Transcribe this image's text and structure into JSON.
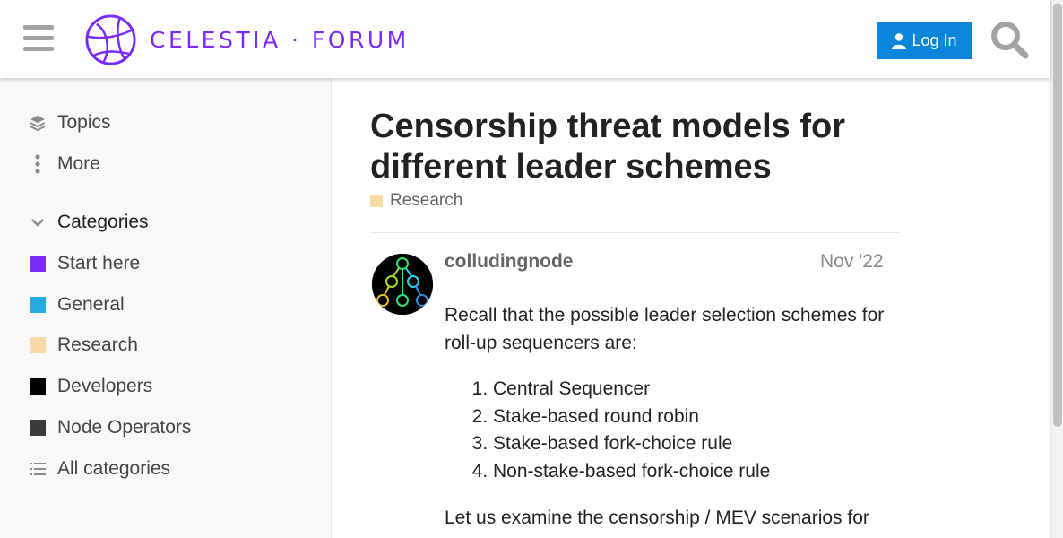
{
  "header": {
    "logo_text": "CELESTIA · FORUM",
    "login_label": "Log In",
    "brand_color": "#7b2bf9",
    "accent_color": "#0a85d9"
  },
  "sidebar": {
    "nav": [
      {
        "label": "Topics",
        "icon": "layers-icon"
      },
      {
        "label": "More",
        "icon": "vertical-ellipsis-icon"
      }
    ],
    "categories_label": "Categories",
    "categories": [
      {
        "label": "Start here",
        "color": "#7b2bf9"
      },
      {
        "label": "General",
        "color": "#25aae1"
      },
      {
        "label": "Research",
        "color": "#f9d9a6"
      },
      {
        "label": "Developers",
        "color": "#000000"
      },
      {
        "label": "Node Operators",
        "color": "#3b3b3b"
      }
    ],
    "all_categories_label": "All categories"
  },
  "topic": {
    "title": "Censorship threat models for different leader schemes",
    "category": "Research",
    "category_color": "#f9d9a6"
  },
  "post": {
    "username": "colludingnode",
    "date": "Nov '22",
    "intro": "Recall that the possible leader selection schemes for roll-up sequencers are:",
    "list": [
      "Central Sequencer",
      "Stake-based round robin",
      "Stake-based fork-choice rule",
      "Non-stake-based fork-choice rule"
    ],
    "followup": "Let us examine the censorship / MEV scenarios for"
  }
}
